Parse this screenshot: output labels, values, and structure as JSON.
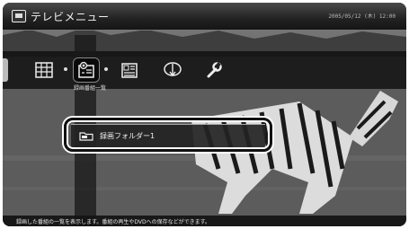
{
  "window": {
    "title": "テレビメニュー",
    "clock": "2005/05/12 (木) 12:00"
  },
  "menu": {
    "items": [
      {
        "icon": "guide-grid-icon"
      },
      {
        "icon": "recording-list-icon",
        "selected": true
      },
      {
        "icon": "program-list-icon"
      },
      {
        "icon": "disc-icon"
      },
      {
        "icon": "wrench-icon"
      }
    ],
    "caption": "録画番組一覧"
  },
  "folder": {
    "label": "録画フォルダー1",
    "icon": "folder-icon"
  },
  "status": {
    "text": "録画した番組の一覧を表示します。番組の再生やDVDへの保存などができます。"
  },
  "colors": {
    "titlebar": "#222222",
    "highlight_ring": "#111111",
    "menu_bar": "#121212"
  }
}
